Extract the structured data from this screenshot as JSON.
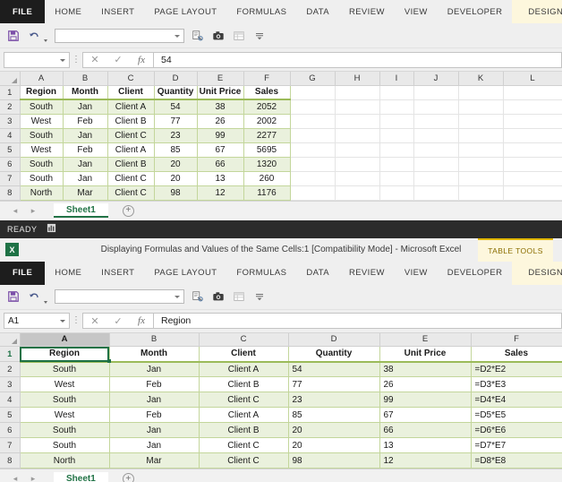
{
  "ribbon": {
    "tabs": [
      "FILE",
      "HOME",
      "INSERT",
      "PAGE LAYOUT",
      "FORMULAS",
      "DATA",
      "REVIEW",
      "VIEW",
      "DEVELOPER",
      "DESIGN"
    ],
    "active_tab": "DESIGN"
  },
  "qat": {
    "icons": [
      "save-icon",
      "undo-icon",
      "combo-box",
      "print-preview-icon",
      "camera-icon",
      "table-icon",
      "customize-icon"
    ]
  },
  "window_top": {
    "namebox_value": "",
    "formula_value": "54",
    "cancel_symbol": "✕",
    "confirm_symbol": "✓",
    "fx_symbol": "fx",
    "columns": [
      "A",
      "B",
      "C",
      "D",
      "E",
      "F",
      "G",
      "H",
      "I",
      "J",
      "K",
      "L"
    ],
    "rows": [
      "1",
      "2",
      "3",
      "4",
      "5",
      "6",
      "7",
      "8"
    ],
    "sheet_tab": "Sheet1",
    "add_sheet_symbol": "+",
    "nav_prev": "◂",
    "nav_next": "▸",
    "status": "READY",
    "status_icon": "macro-record-icon"
  },
  "window_bottom": {
    "title": "Displaying Formulas and Values of the Same Cells:1  [Compatibility Mode] - Microsoft Excel",
    "context_tab_group": "TABLE TOOLS",
    "logo_text": "X",
    "namebox_value": "A1",
    "formula_value": "Region",
    "cancel_symbol": "✕",
    "confirm_symbol": "✓",
    "fx_symbol": "fx",
    "columns": [
      "A",
      "B",
      "C",
      "D",
      "E",
      "F"
    ],
    "rows": [
      "1",
      "2",
      "3",
      "4",
      "5",
      "6",
      "7",
      "8"
    ],
    "selected_cell": "A1",
    "sheet_tab": "Sheet1",
    "add_sheet_symbol": "+",
    "nav_prev": "◂",
    "nav_next": "▸"
  },
  "table_values": {
    "headers": [
      "Region",
      "Month",
      "Client",
      "Quantity",
      "Unit Price",
      "Sales"
    ],
    "rows": [
      [
        "South",
        "Jan",
        "Client A",
        "54",
        "38",
        "2052"
      ],
      [
        "West",
        "Feb",
        "Client B",
        "77",
        "26",
        "2002"
      ],
      [
        "South",
        "Jan",
        "Client C",
        "23",
        "99",
        "2277"
      ],
      [
        "West",
        "Feb",
        "Client A",
        "85",
        "67",
        "5695"
      ],
      [
        "South",
        "Jan",
        "Client B",
        "20",
        "66",
        "1320"
      ],
      [
        "South",
        "Jan",
        "Client C",
        "20",
        "13",
        "260"
      ],
      [
        "North",
        "Mar",
        "Client C",
        "98",
        "12",
        "1176"
      ]
    ]
  },
  "table_formulas": {
    "headers": [
      "Region",
      "Month",
      "Client",
      "Quantity",
      "Unit Price",
      "Sales"
    ],
    "rows": [
      [
        "South",
        "Jan",
        "Client A",
        "54",
        "38",
        "=D2*E2"
      ],
      [
        "West",
        "Feb",
        "Client B",
        "77",
        "26",
        "=D3*E3"
      ],
      [
        "South",
        "Jan",
        "Client C",
        "23",
        "99",
        "=D4*E4"
      ],
      [
        "West",
        "Feb",
        "Client A",
        "85",
        "67",
        "=D5*E5"
      ],
      [
        "South",
        "Jan",
        "Client B",
        "20",
        "66",
        "=D6*E6"
      ],
      [
        "South",
        "Jan",
        "Client C",
        "20",
        "13",
        "=D7*E7"
      ],
      [
        "North",
        "Mar",
        "Client C",
        "98",
        "12",
        "=D8*E8"
      ]
    ]
  },
  "colors": {
    "table_band": "#EAF1DD",
    "table_border": "#C3D69B",
    "table_header_border": "#9BBB59",
    "excel_green": "#217346",
    "context_tab": "#FDF7DD",
    "file_tab": "#1D1D1D"
  }
}
